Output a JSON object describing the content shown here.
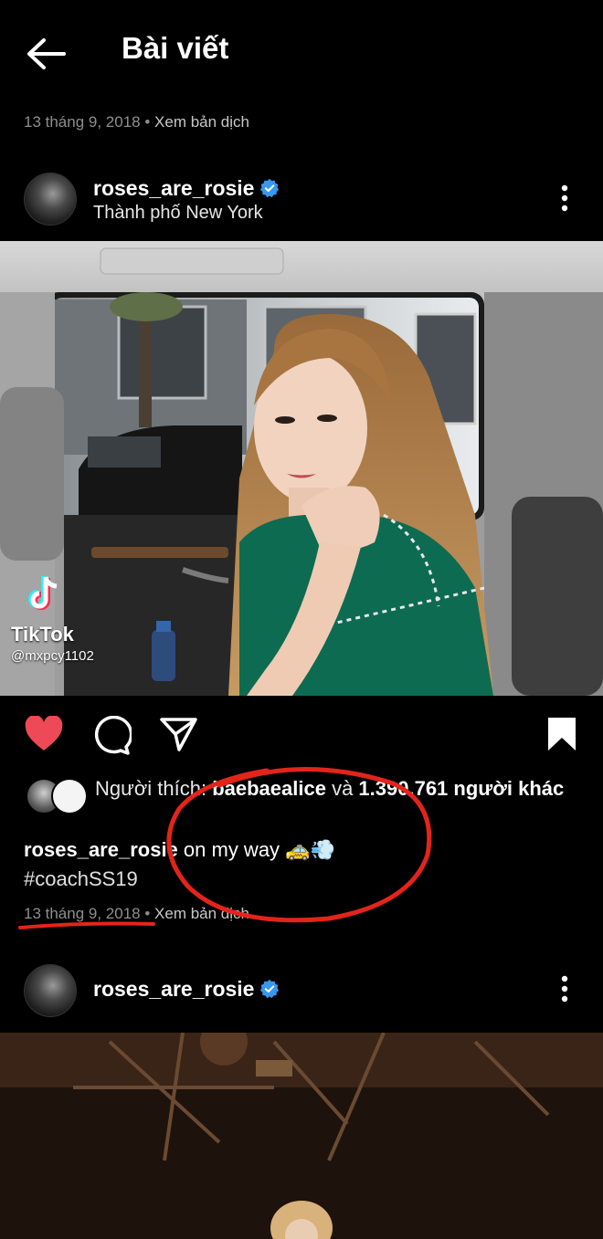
{
  "header": {
    "title": "Bài viết",
    "back_icon": "arrow-left-icon"
  },
  "previous_post": {
    "date": "13 tháng 9, 2018",
    "separator": "•",
    "translate": "Xem bản dịch"
  },
  "post": {
    "username": "roses_are_rosie",
    "verified_color": "#3897f0",
    "location": "Thành phố New York",
    "watermark": {
      "brand": "TikTok",
      "handle": "@mxpcy1102"
    },
    "actions": {
      "like_color": "#ed4956",
      "like_icon": "heart-icon",
      "comment_icon": "comment-icon",
      "share_icon": "send-icon",
      "save_icon": "bookmark-icon"
    },
    "likes": {
      "prefix": "Người thích: ",
      "liker": "baebaealice",
      "suffix_and": " và ",
      "count": "1.390.761",
      "suffix": " người khác"
    },
    "caption": {
      "username": "roses_are_rosie",
      "text": " on my way 🚕💨",
      "hashtag": "#coachSS19"
    },
    "date": "13 tháng 9, 2018",
    "separator": "•",
    "translate": "Xem bản dịch",
    "annotation_color": "#e3241b"
  },
  "next_post": {
    "username": "roses_are_rosie"
  }
}
